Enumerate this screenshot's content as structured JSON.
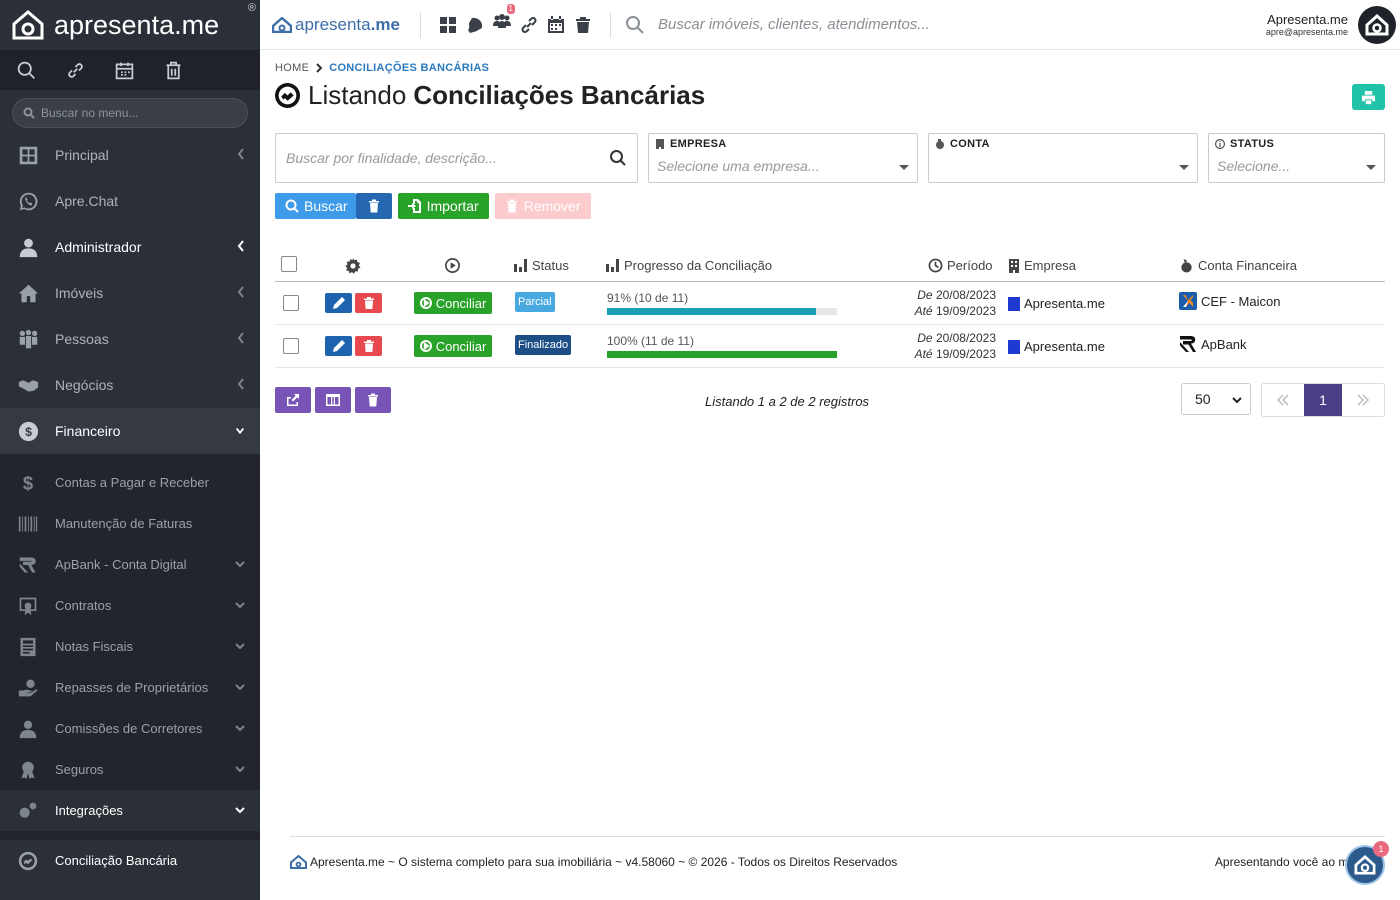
{
  "sidebar": {
    "brand": "apresenta.me",
    "brand_reg": "®",
    "search_placeholder": "Buscar no menu...",
    "items": [
      {
        "label": "Principal"
      },
      {
        "label": "Apre.Chat"
      },
      {
        "label": "Administrador"
      },
      {
        "label": "Imóveis"
      },
      {
        "label": "Pessoas"
      },
      {
        "label": "Negócios"
      },
      {
        "label": "Financeiro"
      }
    ],
    "sub_items": [
      {
        "label": "Contas a Pagar e Receber"
      },
      {
        "label": "Manutenção de Faturas"
      },
      {
        "label": "ApBank - Conta Digital"
      },
      {
        "label": "Contratos"
      },
      {
        "label": "Notas Fiscais"
      },
      {
        "label": "Repasses de Proprietários"
      },
      {
        "label": "Comissões de Corretores"
      },
      {
        "label": "Seguros"
      },
      {
        "label": "Integrações"
      },
      {
        "label": "Conciliação Bancária"
      }
    ]
  },
  "topbar": {
    "logo_text_a": "apresenta",
    "logo_text_b": ".me",
    "notification_count": "1",
    "search_placeholder": "Buscar imóveis, clientes, atendimentos...",
    "user_name": "Apresenta.me",
    "user_email": "apre@apresenta.me"
  },
  "breadcrumb": {
    "home": "HOME",
    "current": "CONCILIAÇÕES BANCÁRIAS"
  },
  "page": {
    "title_prefix": "Listando",
    "title_bold": "Conciliações Bancárias"
  },
  "filters": {
    "search_placeholder": "Buscar por finalidade, descrição...",
    "empresa_label": "EMPRESA",
    "empresa_placeholder": "Selecione uma empresa...",
    "conta_label": "CONTA",
    "conta_value": "",
    "status_label": "STATUS",
    "status_placeholder": "Selecione..."
  },
  "buttons": {
    "search": "Buscar",
    "import": "Importar",
    "remove": "Remover"
  },
  "table": {
    "headers": {
      "status": "Status",
      "progress": "Progresso da Conciliação",
      "period": "Período",
      "company": "Empresa",
      "account": "Conta Financeira"
    },
    "action_label": "Conciliar",
    "from_label": "De",
    "to_label": "Até",
    "rows": [
      {
        "status": "Parcial",
        "progress_text": "91% (10 de 11)",
        "progress_pct": 91,
        "from": "20/08/2023",
        "to": "19/09/2023",
        "company": "Apresenta.me",
        "account": "CEF - Maicon"
      },
      {
        "status": "Finalizado",
        "progress_text": "100% (11 de 11)",
        "progress_pct": 100,
        "from": "20/08/2023",
        "to": "19/09/2023",
        "company": "Apresenta.me",
        "account": "ApBank"
      }
    ]
  },
  "pagination": {
    "listing_text": "Listando 1 a 2 de 2 registros",
    "per_page": "50",
    "current_page": "1"
  },
  "footer": {
    "left": "Apresenta.me ~ O sistema completo para sua imobiliária ~ v4.58060 ~ © 2026 - Todos os Direitos Reservados",
    "right": "Apresentando você ao mu",
    "chat_badge": "1"
  },
  "colors": {
    "sidebar_bg": "#2b3038",
    "accent_blue": "#2a7abf",
    "progress_partial": "#1aa0b5",
    "progress_full": "#28a229",
    "pager_active": "#4a3e87"
  }
}
